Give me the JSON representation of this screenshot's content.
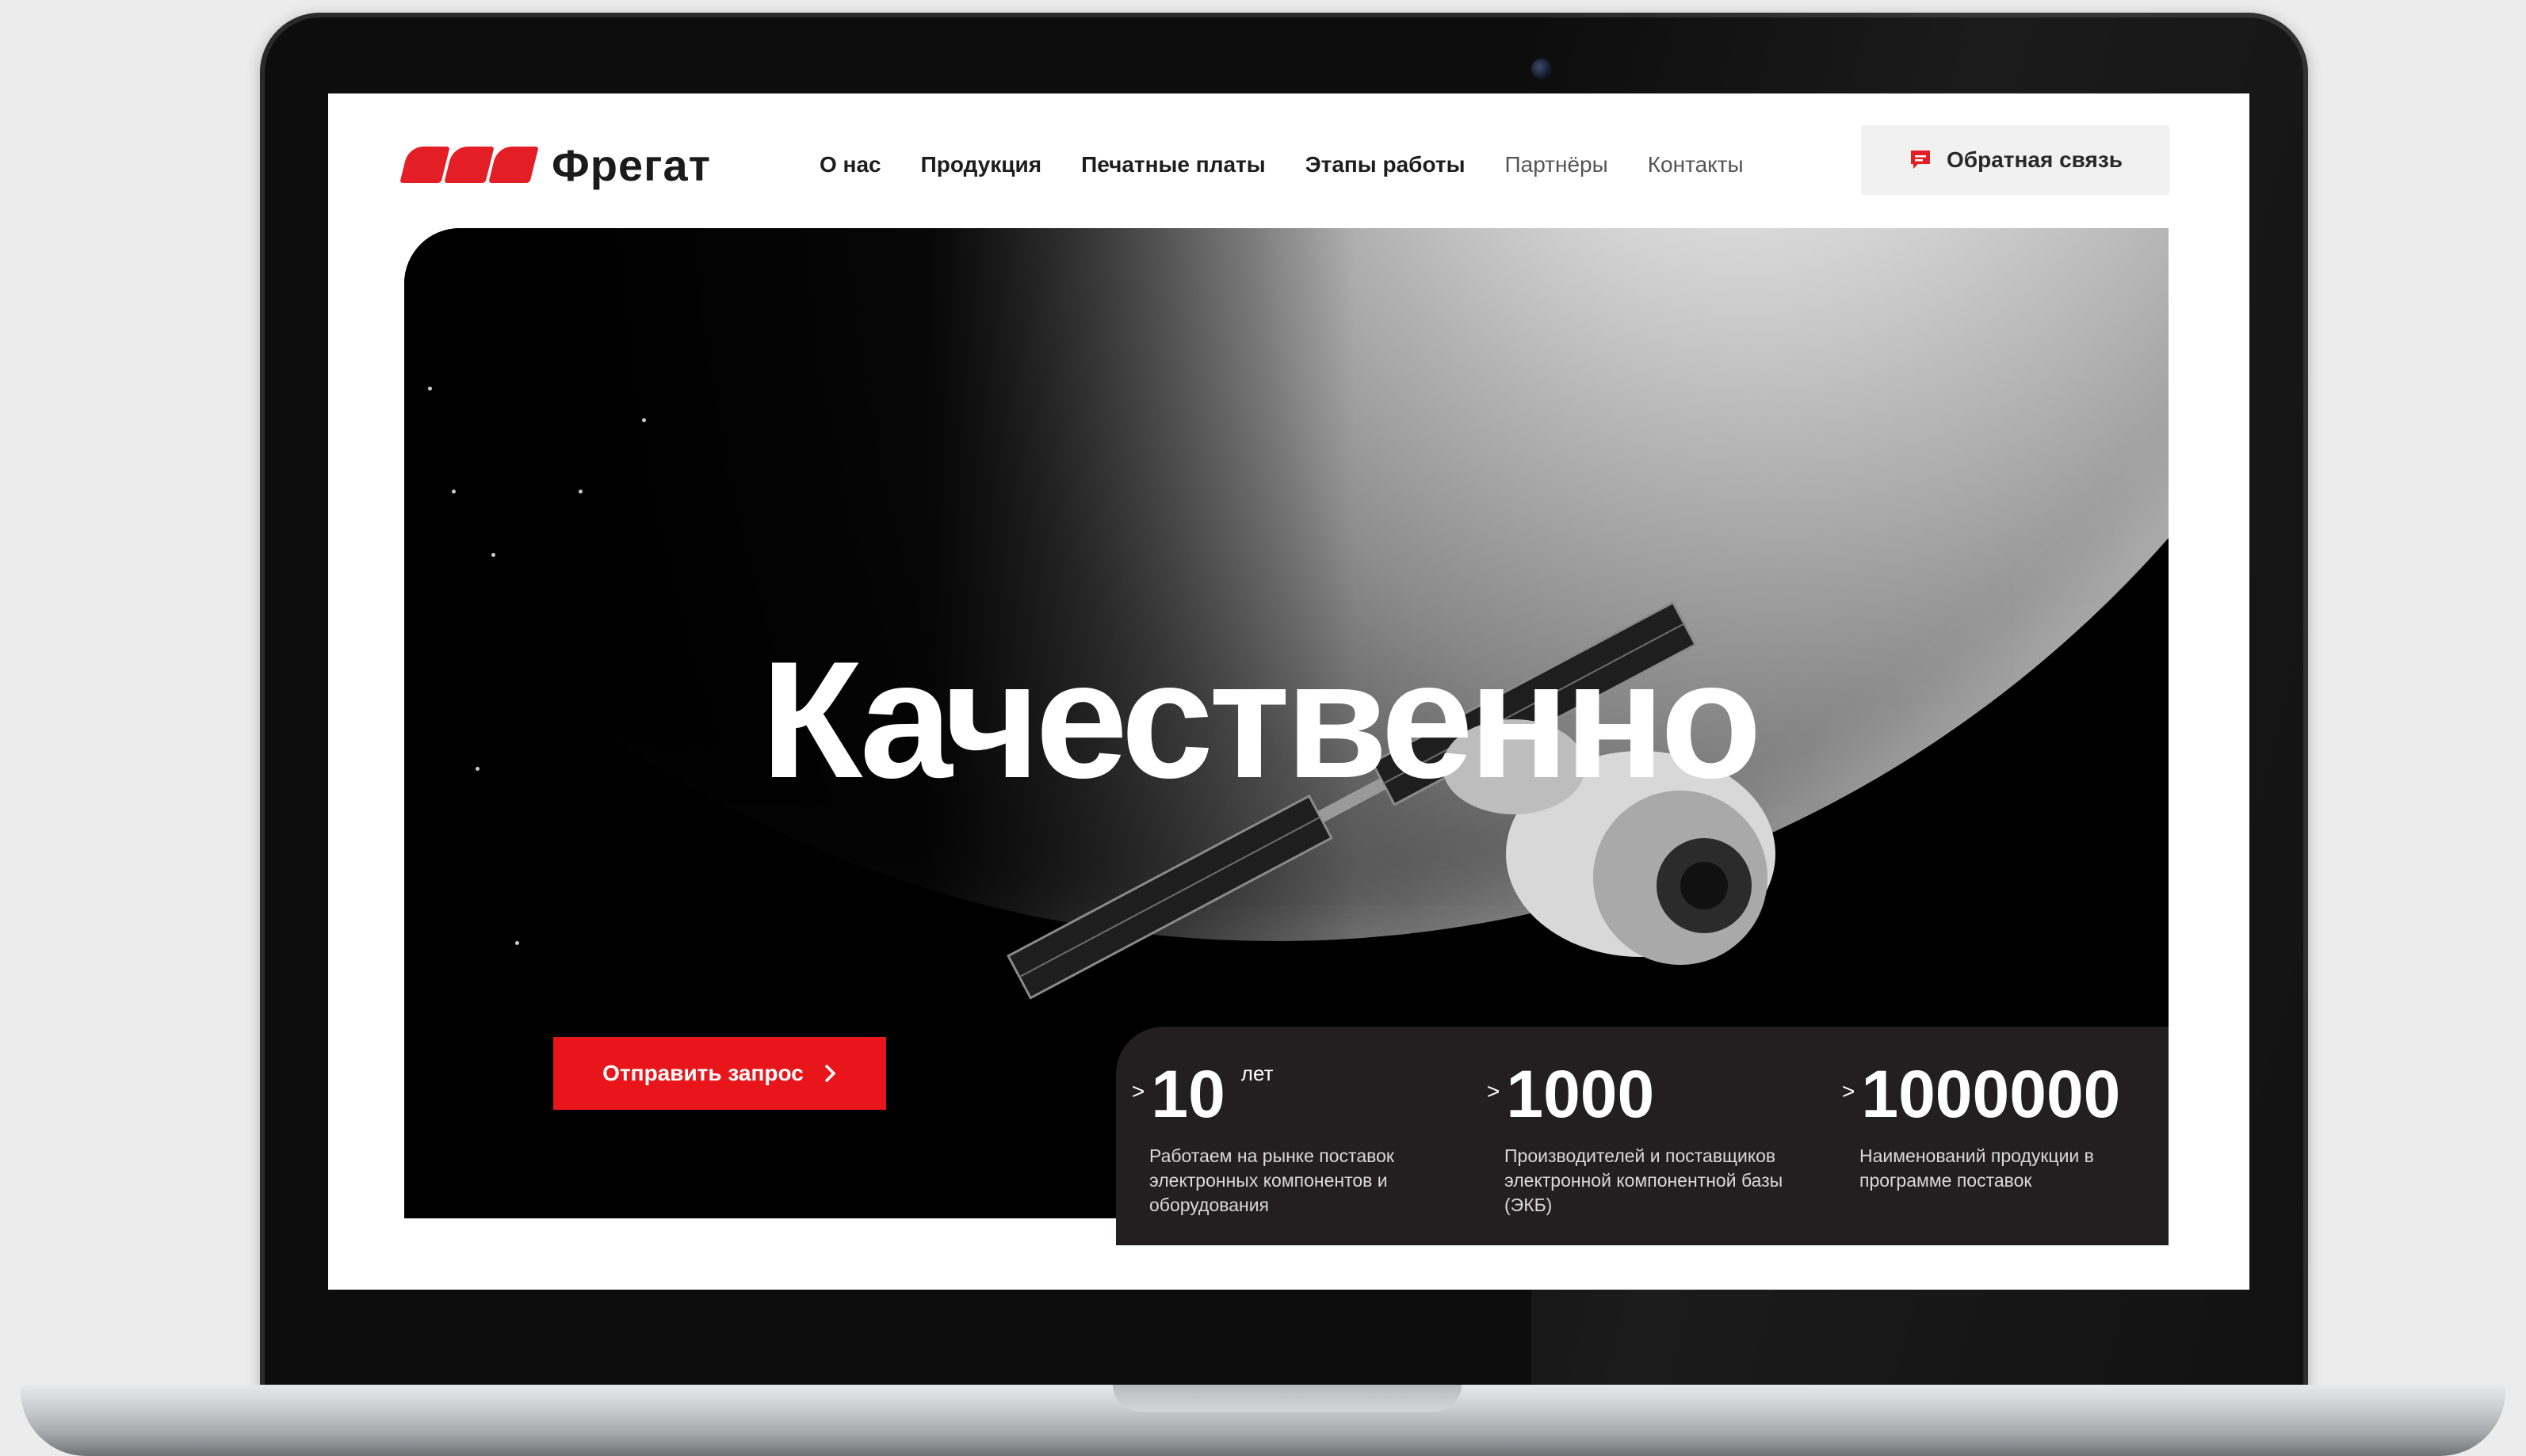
{
  "logo": {
    "text": "Фрегат"
  },
  "nav": {
    "items": [
      {
        "label": "О нас"
      },
      {
        "label": "Продукция"
      },
      {
        "label": "Печатные платы"
      },
      {
        "label": "Этапы работы"
      },
      {
        "label": "Партнёры"
      },
      {
        "label": "Контакты"
      }
    ]
  },
  "header": {
    "feedback_label": "Обратная связь",
    "feedback_icon": "chat-icon"
  },
  "hero": {
    "title": "Качественно",
    "cta_label": "Отправить запрос",
    "cta_icon": "chevron-right-icon"
  },
  "stats": [
    {
      "caret": ">",
      "value": "10",
      "unit": "лет",
      "description": "Работаем на рынке поставок электронных компонентов и оборудования"
    },
    {
      "caret": ">",
      "value": "1000",
      "unit": "",
      "description": "Производителей и поставщиков электронной компонентной базы (ЭКБ)"
    },
    {
      "caret": ">",
      "value": "1000000",
      "unit": "",
      "description": "Наименований продукции в программе поставок"
    }
  ],
  "colors": {
    "accent": "#e8151b",
    "stats_bg": "#231f20",
    "page_bg": "#ececec"
  }
}
